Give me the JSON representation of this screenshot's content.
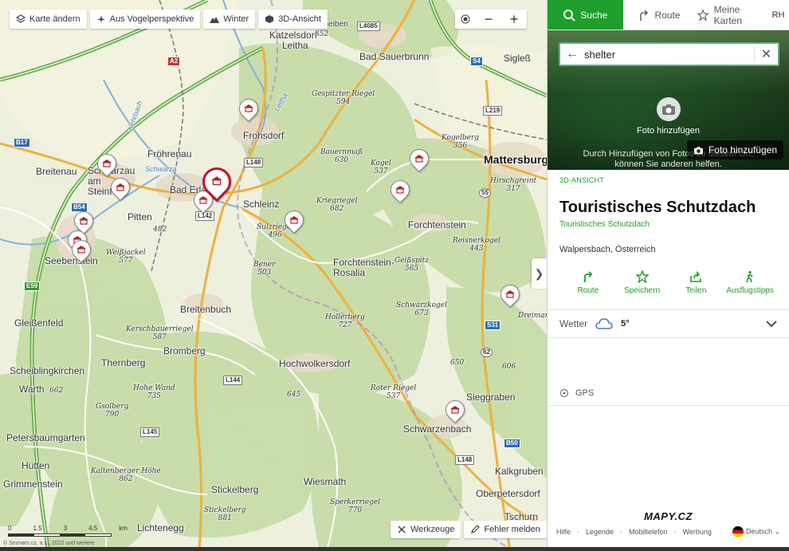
{
  "map": {
    "toolbar": {
      "change_map": "Karte ändern",
      "aerial": "Aus Vogelperspektive",
      "winter": "Winter",
      "view3d": "3D-Ansicht"
    },
    "zoom_in": "+",
    "zoom_out": "−",
    "tools_label": "Werkzeuge",
    "report_label": "Fehler melden",
    "scale": {
      "labels": [
        "0",
        "1.5",
        "3",
        "4.5",
        "km"
      ]
    },
    "copyright": "© Seznam.cz, a.s., 2022 und weitere",
    "places": [
      {
        "name": "Katzelsdorf",
        "type": "town"
      },
      {
        "name": "Leitha",
        "type": "town"
      },
      {
        "name": "Scheiben",
        "type": "town"
      },
      {
        "name": "Bad Sauerbrunn",
        "type": "town"
      },
      {
        "name": "Sigleß",
        "type": "town"
      },
      {
        "name": "Fröhrenau",
        "type": "town"
      },
      {
        "name": "Frohsdorf",
        "type": "town"
      },
      {
        "name": "Breitenau",
        "type": "town"
      },
      {
        "name": "Schwarzau am Steinfeld",
        "type": "town"
      },
      {
        "name": "Bad Erlach",
        "type": "town"
      },
      {
        "name": "Schleinz",
        "type": "town"
      },
      {
        "name": "Pitten",
        "type": "town"
      },
      {
        "name": "Seebenstein",
        "type": "town"
      },
      {
        "name": "Forchtenstein",
        "type": "town"
      },
      {
        "name": "Forchtenstein-Rosalia",
        "type": "town"
      },
      {
        "name": "Mattersburg",
        "type": "city"
      },
      {
        "name": "Breitenbuch",
        "type": "town"
      },
      {
        "name": "Gleißenfeld",
        "type": "town"
      },
      {
        "name": "Bromberg",
        "type": "town"
      },
      {
        "name": "Thernberg",
        "type": "town"
      },
      {
        "name": "Scheiblingkirchen",
        "type": "town"
      },
      {
        "name": "Hochwolkersdorf",
        "type": "town"
      },
      {
        "name": "Warth",
        "type": "town"
      },
      {
        "name": "Sieggraben",
        "type": "town"
      },
      {
        "name": "Schwarzenbach",
        "type": "town"
      },
      {
        "name": "Petersbaumgarten",
        "type": "town"
      },
      {
        "name": "Hütten",
        "type": "town"
      },
      {
        "name": "Grimmenstein",
        "type": "town"
      },
      {
        "name": "Stickelberg",
        "type": "town"
      },
      {
        "name": "Wiesmath",
        "type": "town"
      },
      {
        "name": "Kalkgruben",
        "type": "town"
      },
      {
        "name": "Oberpetersdorf",
        "type": "town"
      },
      {
        "name": "Lichtenegg",
        "type": "town"
      },
      {
        "name": "Tschurn",
        "type": "town"
      },
      {
        "name": "Bad Erlach",
        "type": "town"
      }
    ],
    "peaks": [
      {
        "name": "",
        "elev": "352"
      },
      {
        "name": "Gespitzter Riegel",
        "elev": "594"
      },
      {
        "name": "Bauernmaß",
        "elev": "630"
      },
      {
        "name": "Kogel",
        "elev": "537"
      },
      {
        "name": "Kogelberg",
        "elev": "356"
      },
      {
        "name": "Hirschgreint",
        "elev": "317"
      },
      {
        "name": "Kriegriegel",
        "elev": "682"
      },
      {
        "name": "Sulzriegel",
        "elev": "496"
      },
      {
        "name": "",
        "elev": "482"
      },
      {
        "name": "Weißjackel",
        "elev": "577"
      },
      {
        "name": "Bener",
        "elev": "503"
      },
      {
        "name": "Geißspitz",
        "elev": "565"
      },
      {
        "name": "Reisnerkogel",
        "elev": "443"
      },
      {
        "name": "Schwarzkogel",
        "elev": "673"
      },
      {
        "name": "Hollerberg",
        "elev": "727"
      },
      {
        "name": "Kerschbauerriegel",
        "elev": "587"
      },
      {
        "name": "Hohe Wand",
        "elev": "735"
      },
      {
        "name": "Gsolberg",
        "elev": "790"
      },
      {
        "name": "",
        "elev": "662"
      },
      {
        "name": "",
        "elev": "645"
      },
      {
        "name": "Roter Riegel",
        "elev": "537"
      },
      {
        "name": "",
        "elev": "650"
      },
      {
        "name": "",
        "elev": "606"
      },
      {
        "name": "Kaltenberger Höhe",
        "elev": "862"
      },
      {
        "name": "Sperkerriegel",
        "elev": "770"
      },
      {
        "name": "Stickelberg",
        "elev": "881"
      },
      {
        "name": "Dreimarkstein",
        "elev": ""
      }
    ],
    "rivers": [
      "Leitha",
      "Kehrbach",
      "Schwarza"
    ],
    "shields": [
      "L4085",
      "S4",
      "L219",
      "A2",
      "L148",
      "B17",
      "B54",
      "L142",
      "E59",
      "S31",
      "L144",
      "L145",
      "B50",
      "L148",
      "55",
      "62"
    ]
  },
  "panel": {
    "tabs": {
      "search": "Suche",
      "route": "Route",
      "my_maps": "Meine Karten",
      "avatar": "RH"
    },
    "search": {
      "value": "shelter",
      "placeholder": "Suche"
    },
    "photo": {
      "add_title": "Foto hinzufügen",
      "hint_line1": "Durch Hinzufügen von Fotos zu diesem Ort,",
      "hint_line2": "können Sie anderen helfen.",
      "add_button": "Foto hinzufügen"
    },
    "kicker": "3D-ANSICHT",
    "title": "Touristisches Schutzdach",
    "subtitle": "Touristisches Schutzdach",
    "address": "Walpersbach, Österreich",
    "actions": [
      {
        "label": "Route",
        "icon": "route-icon"
      },
      {
        "label": "Speichern",
        "icon": "star-icon"
      },
      {
        "label": "Teilen",
        "icon": "share-icon"
      },
      {
        "label": "Ausflugstipps",
        "icon": "hiker-icon"
      }
    ],
    "weather": {
      "label": "Wetter",
      "temp": "5°"
    },
    "gps": {
      "label": "GPS"
    },
    "footer": {
      "logo": "MAPY.CZ",
      "links": [
        "Hilfe",
        "Legende",
        "Mobiltelefon",
        "Werbung"
      ],
      "language": "Deutsch"
    }
  },
  "colors": {
    "accent": "#1e9e2a",
    "selected_pin": "#c8102e",
    "map_bg": "#eef0de",
    "forest": "#c5dca6"
  }
}
